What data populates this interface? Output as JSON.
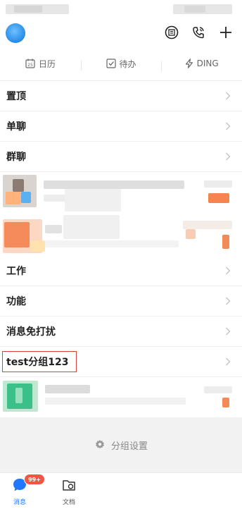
{
  "quick_bar": {
    "calendar": {
      "label": "日历",
      "day": "25"
    },
    "todo": {
      "label": "待办"
    },
    "ding": {
      "label": "DING"
    }
  },
  "groups": [
    {
      "label": "置顶"
    },
    {
      "label": "单聊"
    },
    {
      "label": "群聊"
    },
    {
      "label": "工作"
    },
    {
      "label": "功能"
    },
    {
      "label": "消息免打扰"
    },
    {
      "label": "test分组123"
    }
  ],
  "settings": {
    "label": "分组设置"
  },
  "tabs": {
    "messages": {
      "label": "消息",
      "badge": "99+"
    },
    "docs": {
      "label": "文档"
    }
  },
  "colors": {
    "accent": "#1f78ff",
    "badge": "#f25643",
    "highlight": "#d94040"
  }
}
